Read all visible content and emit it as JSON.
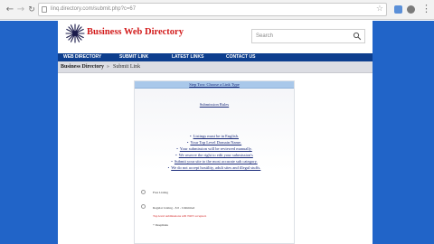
{
  "browser": {
    "url": "linq.directory.com/submit.php?c=67",
    "icons": {
      "back": "arrow-left-icon",
      "forward": "arrow-right-icon",
      "reload": "reload-icon",
      "bookmark": "star-icon",
      "menu": "kebab-menu-icon"
    }
  },
  "site": {
    "logo_text": "Business Web Directory",
    "search_placeholder": "Search",
    "nav": [
      "WEB DIRECTORY",
      "SUBMIT LINK",
      "LATEST LINKS",
      "CONTACT US"
    ],
    "colors": {
      "page_bg": "#2164c8",
      "nav_bg": "#0d3e8e",
      "logo_red": "#d21a1a",
      "link_blue": "#1a2a7a"
    }
  },
  "breadcrumb": {
    "home": "Business Directory",
    "separator": "»",
    "current": "Submit Link"
  },
  "panel": {
    "step_title": "Step Two: Choose a Link Type",
    "sub_heading": "Submission Rules",
    "rules": [
      "Listings must be in English.",
      "Your Top Level Domain Name.",
      "Your submission will be reviewed manually.",
      "We reserve the right to edit your submission's",
      "Submit your site to the most accurate sub category.",
      "We do not accept hostility, adult sites and illegal stuffs."
    ],
    "options": [
      {
        "label": "Free Listing",
        "selected": false
      },
      {
        "label": "Regular Listing - $ 0 - Unlimited",
        "selected": false
      }
    ],
    "option_note": "Top level submissions will NOT accepted.",
    "option_extra": "+ Deeplinks"
  }
}
